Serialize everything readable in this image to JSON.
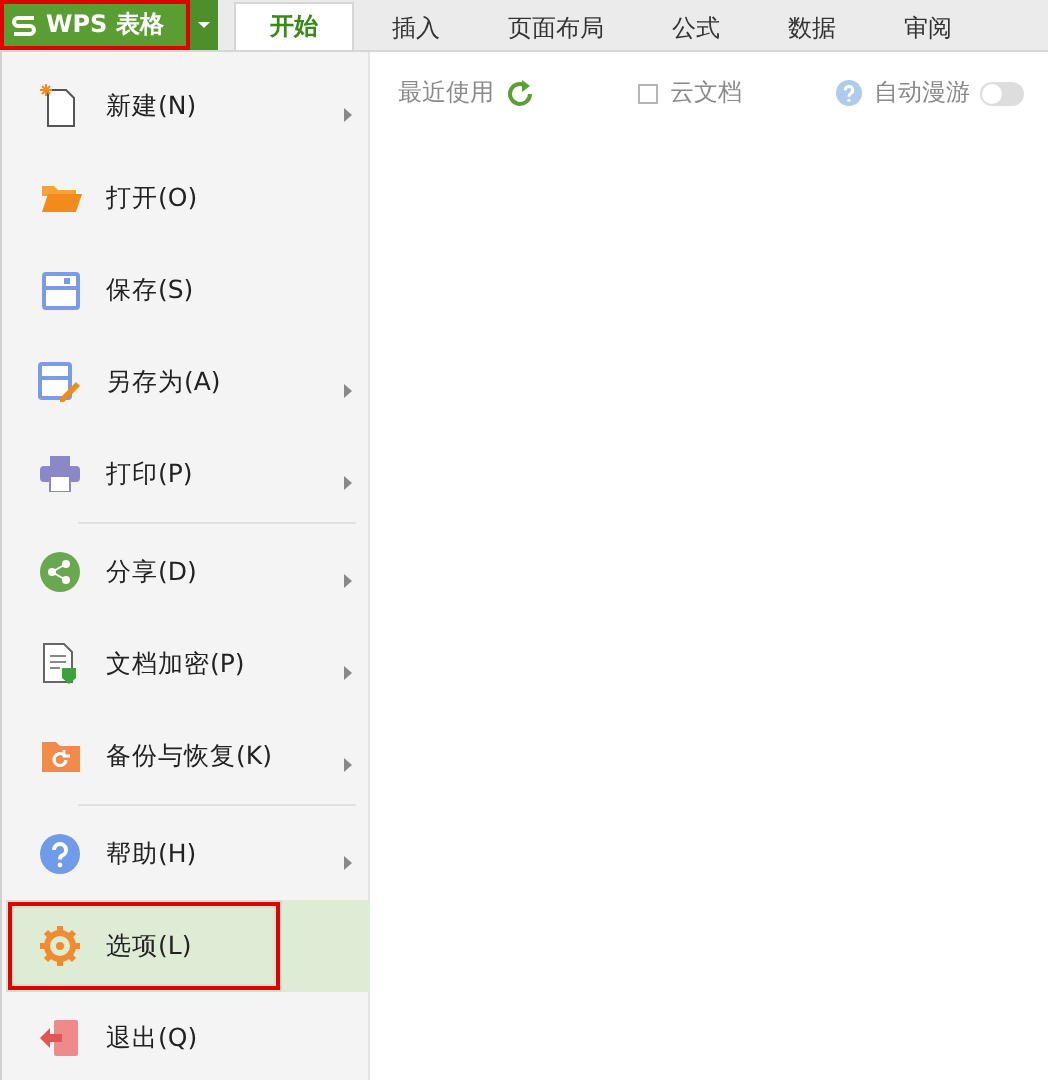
{
  "app_button": {
    "label": "WPS 表格",
    "outlined": true
  },
  "tabs": [
    {
      "label": "开始",
      "selected": true
    },
    {
      "label": "插入",
      "selected": false
    },
    {
      "label": "页面布局",
      "selected": false
    },
    {
      "label": "公式",
      "selected": false
    },
    {
      "label": "数据",
      "selected": false
    },
    {
      "label": "审阅",
      "selected": false
    }
  ],
  "menu": [
    {
      "label": "新建(N)",
      "kind": "new",
      "submenu": true,
      "selected": false,
      "outlined": false,
      "separator_after": false
    },
    {
      "label": "打开(O)",
      "kind": "open",
      "submenu": false,
      "selected": false,
      "outlined": false,
      "separator_after": false
    },
    {
      "label": "保存(S)",
      "kind": "save",
      "submenu": false,
      "selected": false,
      "outlined": false,
      "separator_after": false
    },
    {
      "label": "另存为(A)",
      "kind": "saveas",
      "submenu": true,
      "selected": false,
      "outlined": false,
      "separator_after": false
    },
    {
      "label": "打印(P)",
      "kind": "print",
      "submenu": true,
      "selected": false,
      "outlined": false,
      "separator_after": true
    },
    {
      "label": "分享(D)",
      "kind": "share",
      "submenu": true,
      "selected": false,
      "outlined": false,
      "separator_after": false
    },
    {
      "label": "文档加密(P)",
      "kind": "encrypt",
      "submenu": true,
      "selected": false,
      "outlined": false,
      "separator_after": false
    },
    {
      "label": "备份与恢复(K)",
      "kind": "backup",
      "submenu": true,
      "selected": false,
      "outlined": false,
      "separator_after": true
    },
    {
      "label": "帮助(H)",
      "kind": "help",
      "submenu": true,
      "selected": false,
      "outlined": false,
      "separator_after": false
    },
    {
      "label": "选项(L)",
      "kind": "options",
      "submenu": false,
      "selected": true,
      "outlined": true,
      "separator_after": false
    },
    {
      "label": "退出(Q)",
      "kind": "exit",
      "submenu": false,
      "selected": false,
      "outlined": false,
      "separator_after": false
    }
  ],
  "recent": {
    "label": "最近使用",
    "cloud_checkbox": {
      "label": "云文档",
      "checked": false
    },
    "roaming": {
      "label": "自动漫游",
      "on": false
    }
  }
}
